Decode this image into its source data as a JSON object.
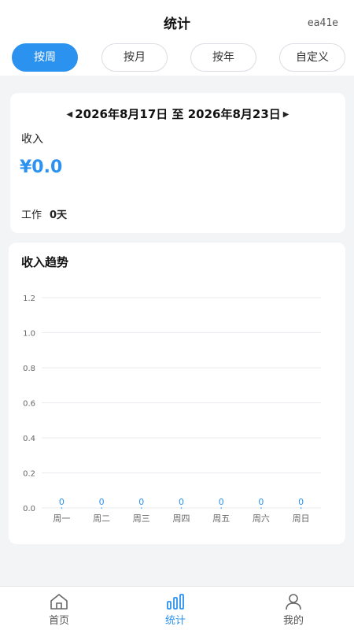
{
  "header": {
    "title": "统计",
    "corner_code": "ea41e"
  },
  "tabs": [
    {
      "label": "按周",
      "active": true
    },
    {
      "label": "按月",
      "active": false
    },
    {
      "label": "按年",
      "active": false
    },
    {
      "label": "自定义",
      "active": false
    }
  ],
  "summary": {
    "date_range": "2026年8月17日 至 2026年8月23日",
    "income_label": "收入",
    "amount": "¥0.0",
    "work_label": "工作",
    "work_value": "0天"
  },
  "trend": {
    "title": "收入趋势"
  },
  "chart_data": {
    "type": "line",
    "categories": [
      "周一",
      "周二",
      "周三",
      "周四",
      "周五",
      "周六",
      "周日"
    ],
    "series": [
      {
        "values": [
          0,
          0,
          0,
          0,
          0,
          0,
          0
        ]
      }
    ],
    "y_ticks": [
      "1.2",
      "1.0",
      "0.8",
      "0.6",
      "0.4",
      "0.2",
      "0.0"
    ],
    "ylim": [
      0,
      1.2
    ],
    "data_labels": [
      "0",
      "0",
      "0",
      "0",
      "0",
      "0",
      "0"
    ],
    "grid": true,
    "colors": {
      "label": "#2c92ef",
      "grid": "#e8ebef",
      "axis_text": "#666666"
    }
  },
  "bottom_nav": [
    {
      "label": "首页",
      "icon": "home-icon",
      "active": false
    },
    {
      "label": "统计",
      "icon": "bar-chart-icon",
      "active": true
    },
    {
      "label": "我的",
      "icon": "user-icon",
      "active": false
    }
  ],
  "colors": {
    "accent": "#2c92ef",
    "background": "#f3f4f6"
  }
}
